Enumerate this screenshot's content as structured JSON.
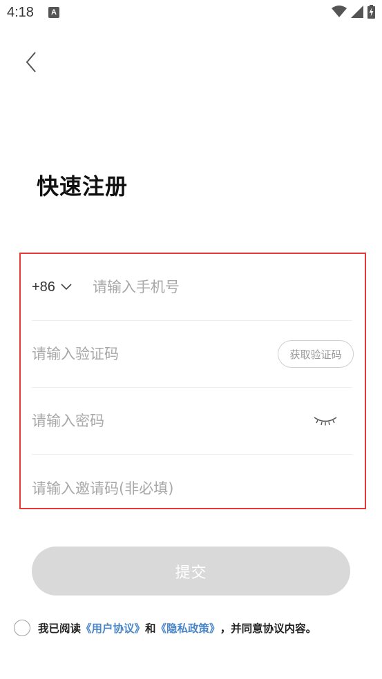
{
  "status_bar": {
    "time": "4:18",
    "notification_badge": "A",
    "icons": [
      "wifi-icon",
      "cellular-signal-icon",
      "battery-charging-icon"
    ]
  },
  "nav": {
    "back_icon": "chevron-left-icon"
  },
  "page": {
    "title": "快速注册"
  },
  "form": {
    "country_code": "+86",
    "phone_placeholder": "请输入手机号",
    "code_placeholder": "请输入验证码",
    "get_code_label": "获取验证码",
    "password_placeholder": "请输入密码",
    "password_toggle_icon": "eye-closed-icon",
    "invite_placeholder": "请输入邀请码(非必填)"
  },
  "submit": {
    "label": "提交"
  },
  "agreement": {
    "prefix": "我已阅读",
    "user_agreement": "《用户协议》",
    "and": "和",
    "privacy_policy": "《隐私政策》",
    "suffix": "，并同意协议内容。"
  },
  "colors": {
    "highlight_border": "#e53935",
    "link": "#4a86c5",
    "button_disabled": "#d9d9d9",
    "placeholder": "#a8a8a8"
  }
}
